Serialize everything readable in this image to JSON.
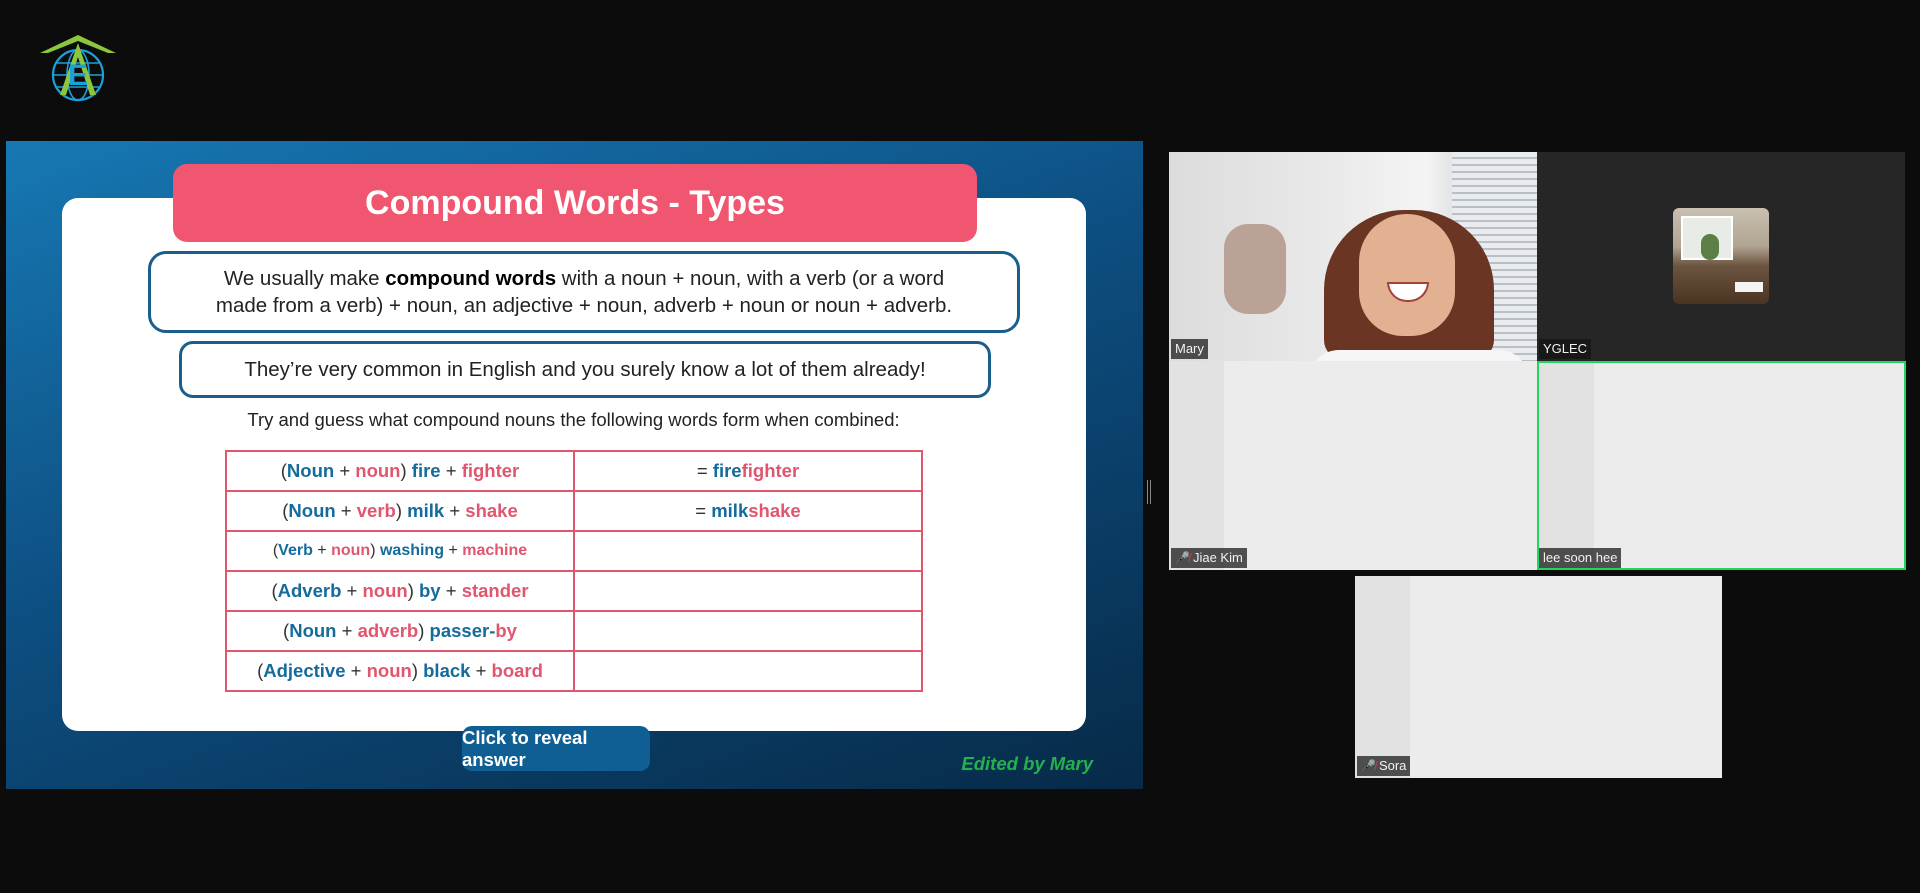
{
  "logo": {
    "letter": "E",
    "colors": {
      "roof": "#8cc63f",
      "globe": "#1ba1d8"
    }
  },
  "slide": {
    "title": "Compound Words - Types",
    "intro": {
      "pre": "We usually make ",
      "bold": "compound words",
      "post_line1": " with a noun + noun, with a verb (or a word",
      "line2": "made from a verb) + noun, an adjective + noun, adverb + noun or noun + adverb."
    },
    "common_text": "They’re very common in English and you surely know a lot of them already!",
    "instruction": "Try and guess what compound nouns the following words form when combined:",
    "rows": [
      {
        "open": "(",
        "t1": "Noun",
        "plus1": " + ",
        "t2": "noun",
        "close": ") ",
        "w1": "fire",
        "plus2": " + ",
        "w2": "fighter",
        "eq": "= ",
        "a1": "fire",
        "a2": "fighter"
      },
      {
        "open": "(",
        "t1": "Noun",
        "plus1": " + ",
        "t2": "verb",
        "close": ") ",
        "w1": "milk",
        "plus2": " + ",
        "w2": "shake",
        "eq": "= ",
        "a1": "milk",
        "a2": "shake"
      },
      {
        "open": "(",
        "t1": "Verb",
        "plus1": " + ",
        "t2": "noun",
        "close": ") ",
        "w1": "washing",
        "plus2": " + ",
        "w2": "machine"
      },
      {
        "open": "(",
        "t1": "Adverb",
        "plus1": " + ",
        "t2": "noun",
        "close": ") ",
        "w1": "by",
        "plus2": " + ",
        "w2": "stander"
      },
      {
        "open": "(",
        "t1": "Noun",
        "plus1": " + ",
        "t2": "adverb",
        "close": ") ",
        "w1": "passer",
        "plus2": "-",
        "w2": "by"
      },
      {
        "open": "(",
        "t1": "Adjective",
        "plus1": " + ",
        "t2": "noun",
        "close": ") ",
        "w1": "black",
        "plus2": " + ",
        "w2": "board"
      }
    ],
    "reveal_button": "Click to reveal answer",
    "edited_by": "Edited by Mary"
  },
  "participants": [
    {
      "name": "Mary",
      "muted": false,
      "video": "camera"
    },
    {
      "name": "YGLEC",
      "muted": false,
      "video": "thumbnail"
    },
    {
      "name": "Jiae Kim",
      "muted": true,
      "video": "off"
    },
    {
      "name": "lee soon hee",
      "muted": false,
      "video": "off",
      "active_speaker": true
    },
    {
      "name": "Sora",
      "muted": true,
      "video": "off"
    }
  ],
  "icons": {
    "muted": "mic-muted-icon"
  },
  "colors": {
    "accent_pink": "#f0566f",
    "accent_blue": "#1a5f8c",
    "active_border": "#1fd65e",
    "edited_green": "#22b14c"
  }
}
